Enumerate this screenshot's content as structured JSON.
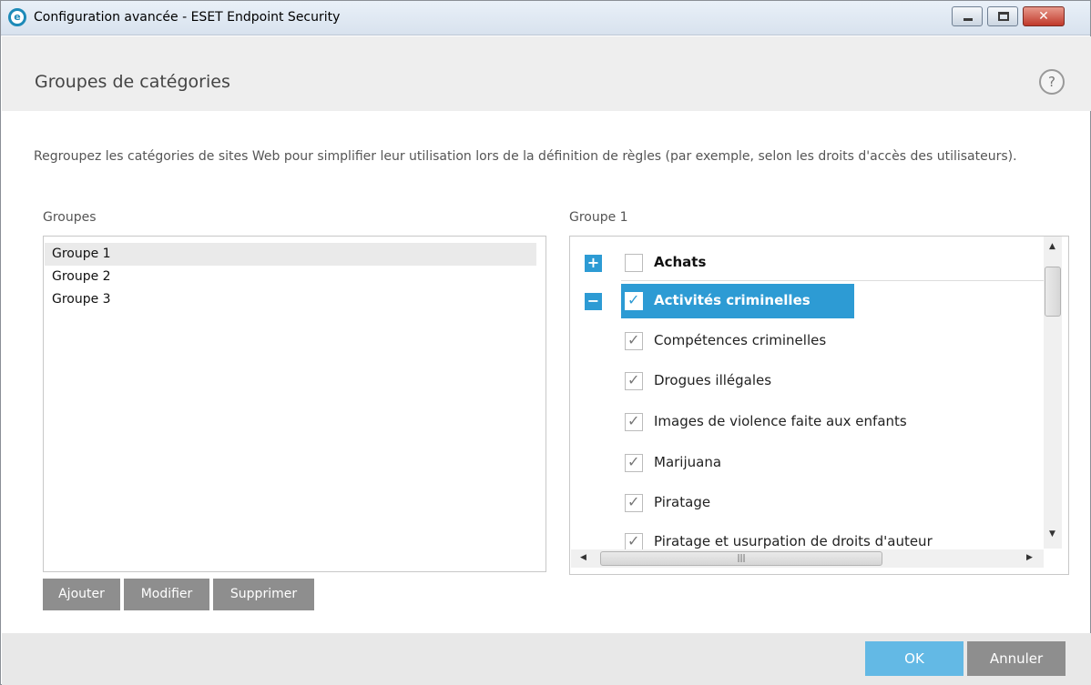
{
  "window": {
    "title": "Configuration avancée - ESET Endpoint Security",
    "app_icon_letter": "e",
    "controls": [
      "minimize",
      "maximize",
      "close"
    ]
  },
  "header": {
    "title": "Groupes de catégories",
    "help_symbol": "?"
  },
  "description": "Regroupez les catégories de sites Web pour simplifier leur utilisation lors de la définition de règles (par exemple, selon les droits d'accès des utilisateurs).",
  "groups": {
    "label": "Groupes",
    "items": [
      "Groupe 1",
      "Groupe 2",
      "Groupe 3"
    ],
    "selected_index": 0,
    "buttons": {
      "add": "Ajouter",
      "edit": "Modifier",
      "delete": "Supprimer"
    }
  },
  "categories": {
    "label": "Groupe 1",
    "parents": [
      {
        "label": "Achats",
        "expanded": false,
        "checked": false
      },
      {
        "label": "Activités criminelles",
        "expanded": true,
        "checked": true,
        "selected": true
      }
    ],
    "children": [
      {
        "label": "Compétences criminelles",
        "checked": true
      },
      {
        "label": "Drogues illégales",
        "checked": true
      },
      {
        "label": "Images de violence faite aux enfants",
        "checked": true
      },
      {
        "label": "Marijuana",
        "checked": true
      },
      {
        "label": "Piratage",
        "checked": true
      },
      {
        "label": "Piratage et usurpation de droits d'auteur",
        "checked": true
      }
    ]
  },
  "footer": {
    "ok": "OK",
    "cancel": "Annuler"
  },
  "colors": {
    "accent": "#2d9bd4",
    "ok_button": "#63b9e5",
    "gray_button": "#8e8e8e"
  }
}
